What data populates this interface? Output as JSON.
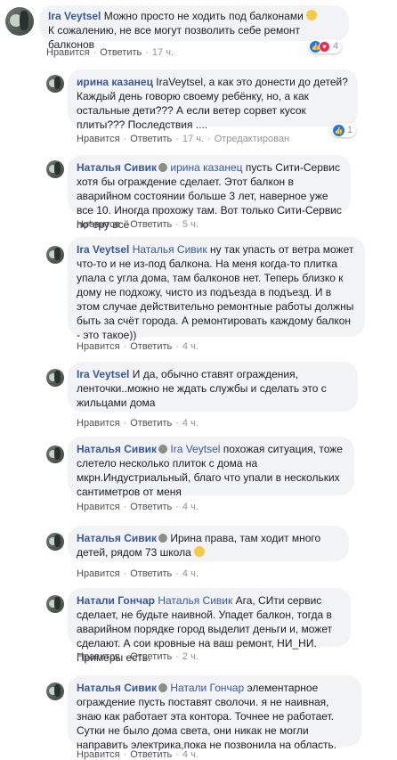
{
  "actions": {
    "like": "Нравится",
    "reply": "Ответить",
    "edited": "Отредактирован",
    "sep": "·"
  },
  "comments": [
    {
      "author": "Ira Veytsel",
      "mention": "",
      "text": "Можно просто не ходить под балконами",
      "text2": "К сожалению, не все могут позволить себе ремонт балконов",
      "time": "17 ч.",
      "reactions": "4"
    },
    {
      "author": "ирина казанец",
      "mention": "",
      "text": "IraVeytsel, а как это донести до детей? Каждый день говорю своему ребёнку, но, а как остальные дети??? А если ветер сорвет кусок плиты??? Последствия ....",
      "time": "17 ч.",
      "edited": true,
      "reactions": "1"
    },
    {
      "author": "Наталья Сивик",
      "mention": "ирина казанец",
      "text": "пусть Сити-Сервис хотя бы ограждение сделает. Этот балкон в аварийном состоянии больше 3 лет, наверное уже все 10. Иногда прохожу там. Вот только Сити-Сервис по*еру всё",
      "time": "5 ч."
    },
    {
      "author": "Ira Veytsel",
      "mention": "Наталья Сивик",
      "text": "ну так упасть от ветра может что-то и не из-под балкона. На меня когда-то плитка упала с угла дома, там балконов нет. Теперь близко к дому не подхожу, чисто из подъезда в подъезд. И в этом случае действительно ремонтные работы должны быть за счёт города. А ремонтировать каждому балкон - это такое))",
      "time": "4 ч."
    },
    {
      "author": "Ira Veytsel",
      "mention": "",
      "text": "И да, обычно ставят ограждения, ленточки..можно не ждать службы и сделать это с жильцами дома",
      "time": "4 ч."
    },
    {
      "author": "Наталья Сивик",
      "mention": "Ira Veytsel",
      "text": "похожая ситуация, тоже слетело несколько плиток с дома на мкрн.Индустриальный, благо что упали в нескольких сантиметров от меня",
      "time": "4 ч."
    },
    {
      "author": "Наталья Сивик",
      "mention": "",
      "text": "Ирина права, там ходит много детей, рядом 73 школа",
      "time": "4 ч."
    },
    {
      "author": "Натали Гончар",
      "mention": "Наталья Сивик",
      "text": "Ага, СИти сервис сделает, не будьте наивной. Упадет балкон, тогда в аварийном порядке город выделит деньги и, может сделают. А сои кровные на ваш ремонт, НИ_НИ. Примеры есть.",
      "time": "2 ч."
    },
    {
      "author": "Наталья Сивик",
      "mention": "Натали Гончар",
      "text": "элементарное ограждение пусть поставят сволочи. я не наивная, знаю как работает эта контора. Точнее не работает. Сутки не было дома света, они никак не могли направить электрика,пока не позвонила на область.",
      "time": "4 ч."
    }
  ]
}
